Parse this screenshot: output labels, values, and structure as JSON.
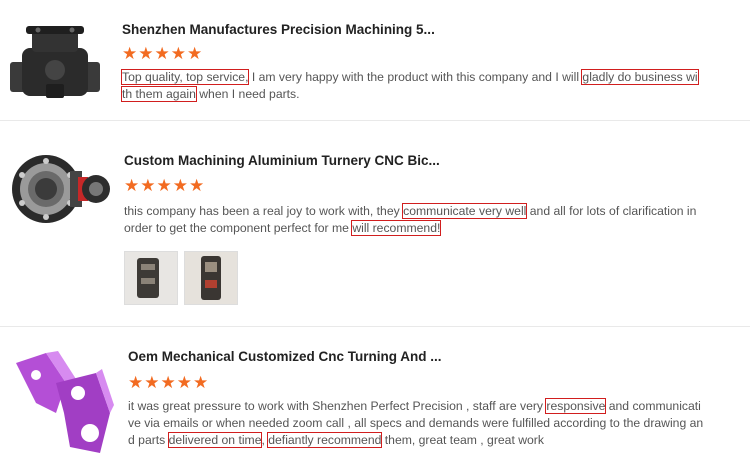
{
  "reviews": [
    {
      "title": "Shenzhen Manufactures Precision Machining 5...",
      "rating": 5,
      "stars": "★★★★★",
      "lines": [
        [
          {
            "t": "Top quality, top service,",
            "hl": true
          },
          {
            "t": " I am very happy with the product with this company and I will ",
            "hl": false
          },
          {
            "t": "gladly do business wi",
            "hl": true
          }
        ],
        [
          {
            "t": "th them again",
            "hl": true
          },
          {
            "t": " when I need parts.",
            "hl": false
          }
        ]
      ]
    },
    {
      "title": "Custom Machining Aluminium Turnery CNC Bic...",
      "rating": 5,
      "stars": "★★★★★",
      "lines": [
        [
          {
            "t": "this company has been a real joy to work with, they ",
            "hl": false
          },
          {
            "t": "communicate very well",
            "hl": true
          },
          {
            "t": " and all for lots of clarification in",
            "hl": false
          }
        ],
        [
          {
            "t": "order to get the component perfect for me ",
            "hl": false
          },
          {
            "t": "will recommend!",
            "hl": true
          }
        ]
      ]
    },
    {
      "title": "Oem Mechanical Customized Cnc Turning And ...",
      "rating": 5,
      "stars": "★★★★★",
      "lines": [
        [
          {
            "t": "it was great pressure to work with Shenzhen Perfect Precision , staff are very ",
            "hl": false
          },
          {
            "t": "responsive",
            "hl": true
          },
          {
            "t": " and communicati",
            "hl": false
          }
        ],
        [
          {
            "t": "ve via  emails or when needed zoom call , all specs and demands were fulfilled according to the drawing an",
            "hl": false
          }
        ],
        [
          {
            "t": "d parts ",
            "hl": false
          },
          {
            "t": "delivered on time",
            "hl": true
          },
          {
            "t": ", ",
            "hl": false
          },
          {
            "t": "defiantly recommend",
            "hl": true
          },
          {
            "t": " them, great team , great work",
            "hl": false
          }
        ]
      ]
    }
  ],
  "icons": [
    "pipe-fitting-icon",
    "bearing-hub-icon",
    "purple-bracket-icon"
  ],
  "colors": {
    "star": "#f26b21",
    "highlight_border": "#d11e1e",
    "text": "#555555",
    "title": "#222222",
    "purple_part": "#b44fd6"
  }
}
